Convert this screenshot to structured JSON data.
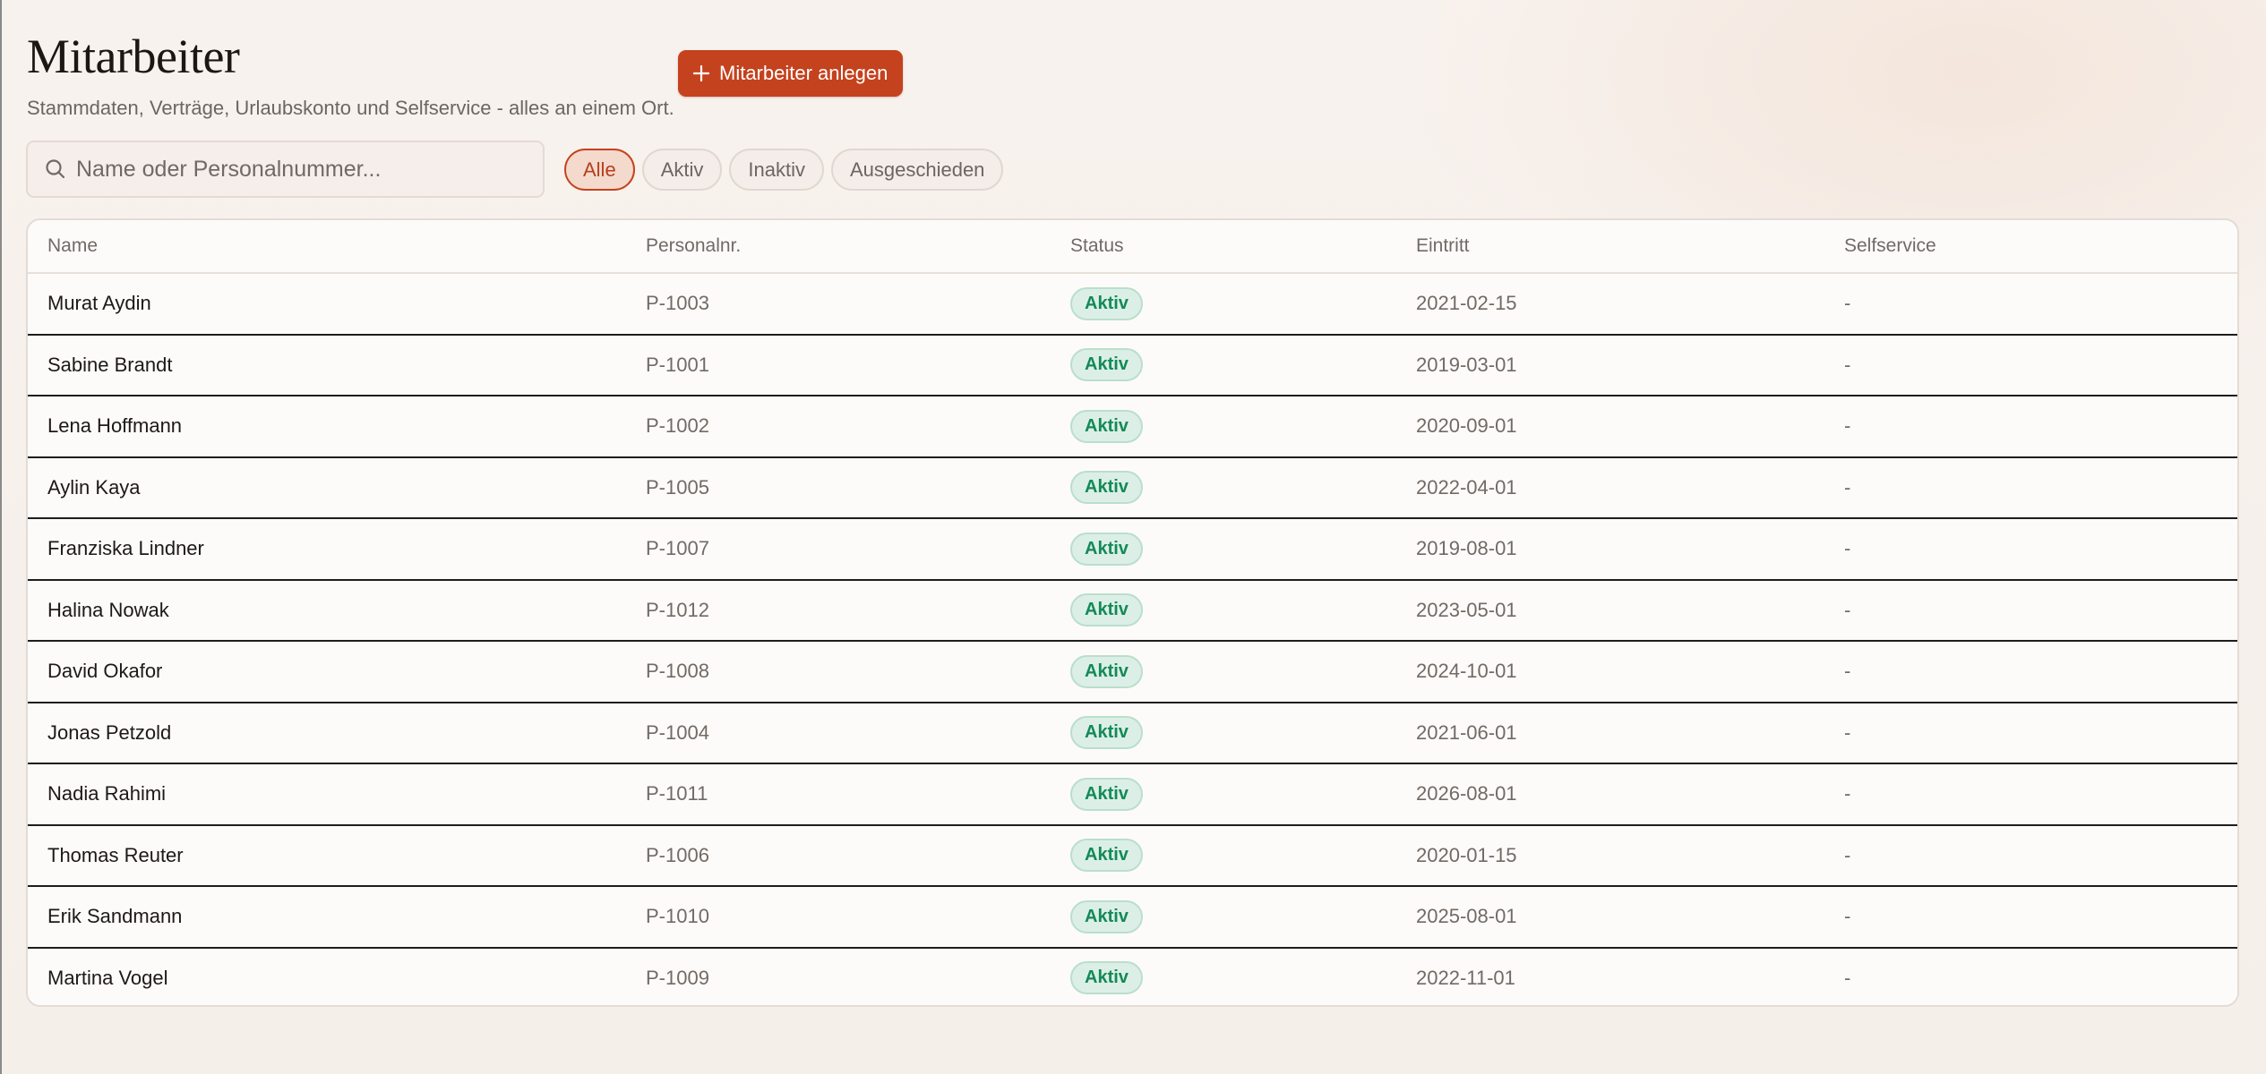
{
  "header": {
    "title": "Mitarbeiter",
    "subtitle": "Stammdaten, Verträge, Urlaubskonto und Selfservice - alles an einem Ort.",
    "add_button_label": "Mitarbeiter anlegen",
    "add_button_icon": "plus-icon"
  },
  "search": {
    "placeholder": "Name oder Personalnummer...",
    "value": "",
    "icon": "search-icon"
  },
  "filters": [
    {
      "label": "Alle",
      "active": true
    },
    {
      "label": "Aktiv",
      "active": false
    },
    {
      "label": "Inaktiv",
      "active": false
    },
    {
      "label": "Ausgeschieden",
      "active": false
    }
  ],
  "table": {
    "columns": [
      "Name",
      "Personalnr.",
      "Status",
      "Eintritt",
      "Selfservice"
    ],
    "rows": [
      {
        "name": "Murat Aydin",
        "nr": "P-1003",
        "status": "Aktiv",
        "eintritt": "2021-02-15",
        "selfservice": "-"
      },
      {
        "name": "Sabine Brandt",
        "nr": "P-1001",
        "status": "Aktiv",
        "eintritt": "2019-03-01",
        "selfservice": "-"
      },
      {
        "name": "Lena Hoffmann",
        "nr": "P-1002",
        "status": "Aktiv",
        "eintritt": "2020-09-01",
        "selfservice": "-"
      },
      {
        "name": "Aylin Kaya",
        "nr": "P-1005",
        "status": "Aktiv",
        "eintritt": "2022-04-01",
        "selfservice": "-"
      },
      {
        "name": "Franziska Lindner",
        "nr": "P-1007",
        "status": "Aktiv",
        "eintritt": "2019-08-01",
        "selfservice": "-"
      },
      {
        "name": "Halina Nowak",
        "nr": "P-1012",
        "status": "Aktiv",
        "eintritt": "2023-05-01",
        "selfservice": "-"
      },
      {
        "name": "David Okafor",
        "nr": "P-1008",
        "status": "Aktiv",
        "eintritt": "2024-10-01",
        "selfservice": "-"
      },
      {
        "name": "Jonas Petzold",
        "nr": "P-1004",
        "status": "Aktiv",
        "eintritt": "2021-06-01",
        "selfservice": "-"
      },
      {
        "name": "Nadia Rahimi",
        "nr": "P-1011",
        "status": "Aktiv",
        "eintritt": "2026-08-01",
        "selfservice": "-"
      },
      {
        "name": "Thomas Reuter",
        "nr": "P-1006",
        "status": "Aktiv",
        "eintritt": "2020-01-15",
        "selfservice": "-"
      },
      {
        "name": "Erik Sandmann",
        "nr": "P-1010",
        "status": "Aktiv",
        "eintritt": "2025-08-01",
        "selfservice": "-"
      },
      {
        "name": "Martina Vogel",
        "nr": "P-1009",
        "status": "Aktiv",
        "eintritt": "2022-11-01",
        "selfservice": "-"
      }
    ]
  },
  "colors": {
    "accent": "#c4421d",
    "status_active_text": "#138a57",
    "status_active_bg": "#dcefe6"
  }
}
